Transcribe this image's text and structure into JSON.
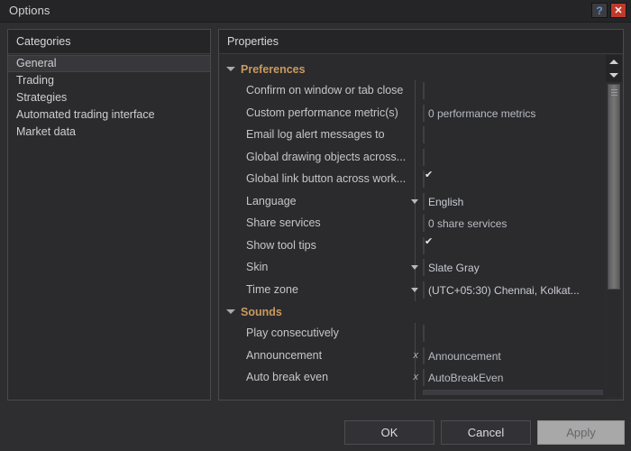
{
  "window": {
    "title": "Options",
    "help_label": "?",
    "close_label": "✕"
  },
  "categories_panel": {
    "header": "Categories",
    "items": [
      {
        "label": "General",
        "selected": true
      },
      {
        "label": "Trading",
        "selected": false
      },
      {
        "label": "Strategies",
        "selected": false
      },
      {
        "label": "Automated trading interface",
        "selected": false
      },
      {
        "label": "Market data",
        "selected": false
      }
    ]
  },
  "properties_panel": {
    "header": "Properties",
    "sections": [
      {
        "label": "Preferences",
        "expanded": true,
        "rows": [
          {
            "label": "Confirm on window or tab close",
            "type": "checkbox",
            "checked": false
          },
          {
            "label": "Custom performance metric(s)",
            "type": "field",
            "value": "0 performance metrics",
            "clear": ""
          },
          {
            "label": "Email log alert messages to",
            "type": "field",
            "value": "",
            "clear": ""
          },
          {
            "label": "Global drawing objects across...",
            "type": "checkbox",
            "checked": false
          },
          {
            "label": "Global link button across work...",
            "type": "checkbox",
            "checked": true
          },
          {
            "label": "Language",
            "type": "combo",
            "value": "English"
          },
          {
            "label": "Share services",
            "type": "field",
            "value": "0 share services",
            "clear": ""
          },
          {
            "label": "Show tool tips",
            "type": "checkbox",
            "checked": true
          },
          {
            "label": "Skin",
            "type": "combo",
            "value": "Slate Gray"
          },
          {
            "label": "Time zone",
            "type": "combo",
            "value": "(UTC+05:30) Chennai, Kolkat..."
          }
        ]
      },
      {
        "label": "Sounds",
        "expanded": true,
        "rows": [
          {
            "label": "Play consecutively",
            "type": "checkbox",
            "checked": false
          },
          {
            "label": "Announcement",
            "type": "field",
            "value": "Announcement",
            "clear": "x"
          },
          {
            "label": "Auto break even",
            "type": "field",
            "value": "AutoBreakEven",
            "clear": "x"
          }
        ]
      }
    ],
    "scrollbar": {
      "up_arrow": "scroll-up-arrow",
      "down_arrow": "scroll-down-arrow"
    }
  },
  "footer": {
    "ok_label": "OK",
    "cancel_label": "Cancel",
    "apply_label": "Apply",
    "apply_disabled": true
  },
  "colors": {
    "window_bg": "#2e2e31",
    "panel_bg": "#2b2b2e",
    "header_bg": "#252528",
    "section_accent": "#c99a5e",
    "text": "#cfcfd2",
    "field_bg": "#3b3b41",
    "close_btn": "#c0392b",
    "help_glyph": "#5b9bd5",
    "apply_disabled_bg": "#a8a8a8"
  }
}
